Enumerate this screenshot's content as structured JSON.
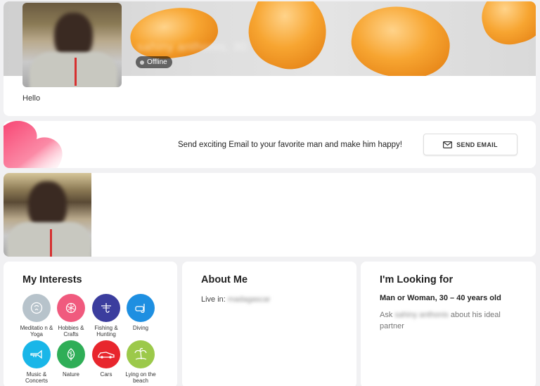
{
  "profile": {
    "name": "sahiny anthonis, 30",
    "status": "Offline",
    "greeting": "Hello"
  },
  "email_banner": {
    "text": "Send exciting Email to your favorite man and make him happy!",
    "button_label": "SEND EMAIL",
    "button_icon": "envelope-icon"
  },
  "interests": {
    "title": "My Interests",
    "items": [
      {
        "label": "Meditatio n & Yoga",
        "icon": "yoga-icon",
        "color": "#b7c3cb"
      },
      {
        "label": "Hobbies & Crafts",
        "icon": "yarn-icon",
        "color": "#f05a7e"
      },
      {
        "label": "Fishing & Hunting",
        "icon": "fishing-icon",
        "color": "#3b3d9e"
      },
      {
        "label": "Diving",
        "icon": "snorkel-icon",
        "color": "#1e8fe1"
      },
      {
        "label": "Music & Concerts",
        "icon": "trumpet-icon",
        "color": "#19b6e8"
      },
      {
        "label": "Nature",
        "icon": "leaf-icon",
        "color": "#2fae57"
      },
      {
        "label": "Cars",
        "icon": "car-icon",
        "color": "#e8262d"
      },
      {
        "label": "Lying on the beach",
        "icon": "palm-icon",
        "color": "#9cc94a"
      }
    ]
  },
  "about": {
    "title": "About Me",
    "live_in_label": "Live in:",
    "live_in_value": "madagascar"
  },
  "looking_for": {
    "title": "I'm Looking for",
    "subtitle": "Man or Woman, 30 – 40 years old",
    "ask_prefix": "Ask",
    "ask_name": "sahiny anthonis",
    "ask_suffix": "about his ideal partner"
  }
}
